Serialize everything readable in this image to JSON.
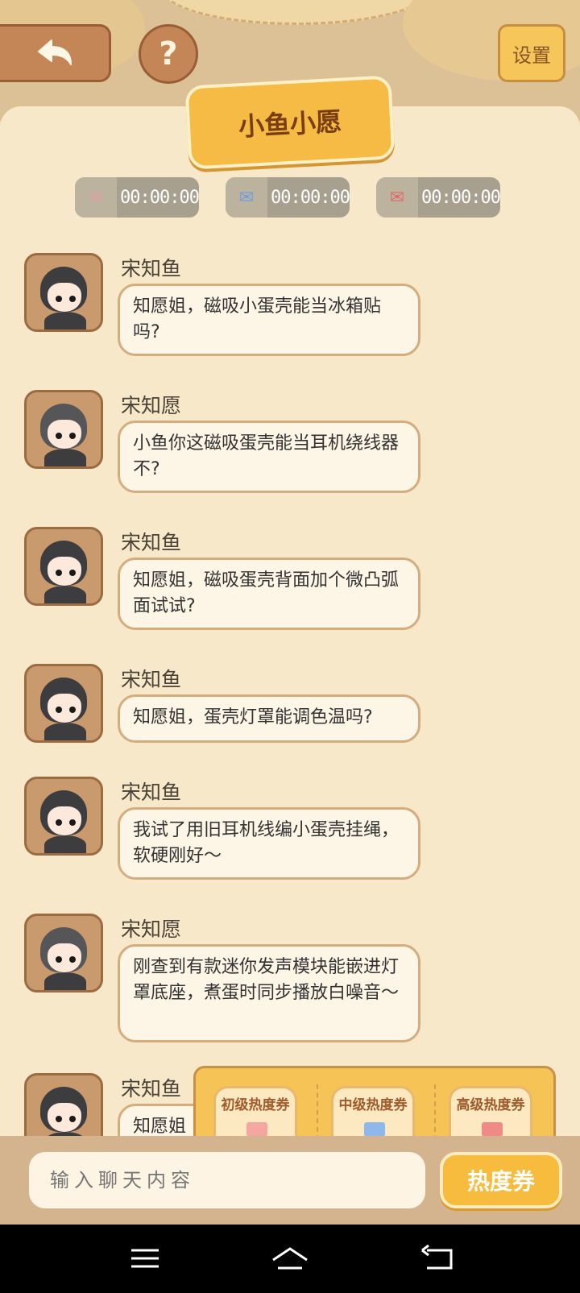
{
  "header": {
    "settings_label": "设置",
    "help_label": "?",
    "title": "小鱼小愿"
  },
  "timers": [
    {
      "icon": "gift-card-icon-tan",
      "time": "00:00:00"
    },
    {
      "icon": "gift-card-icon-blue",
      "time": "00:00:00"
    },
    {
      "icon": "gift-card-icon-red",
      "time": "00:00:00"
    }
  ],
  "messages": [
    {
      "sender": "宋知鱼",
      "text": "知愿姐，磁吸小蛋壳能当冰箱贴吗?"
    },
    {
      "sender": "宋知愿",
      "text": "小鱼你这磁吸蛋壳能当耳机绕线器不?"
    },
    {
      "sender": "宋知鱼",
      "text": "知愿姐，磁吸蛋壳背面加个微凸弧面试试?"
    },
    {
      "sender": "宋知鱼",
      "text": "知愿姐，蛋壳灯罩能调色温吗?"
    },
    {
      "sender": "宋知鱼",
      "text": "我试了用旧耳机线编小蛋壳挂绳，软硬刚好～"
    },
    {
      "sender": "宋知愿",
      "text": "刚查到有款迷你发声模块能嵌进灯罩底座，煮蛋时同步播放白噪音～"
    },
    {
      "sender": "宋知鱼",
      "text": "知愿姐"
    }
  ],
  "coupons": [
    {
      "label": "初级热度券",
      "color": "#f4a7a0"
    },
    {
      "label": "中级热度券",
      "color": "#8fb8ea"
    },
    {
      "label": "高级热度券",
      "color": "#ef8a86"
    }
  ],
  "input": {
    "placeholder": "输入聊天内容",
    "heat_button": "热度券"
  }
}
